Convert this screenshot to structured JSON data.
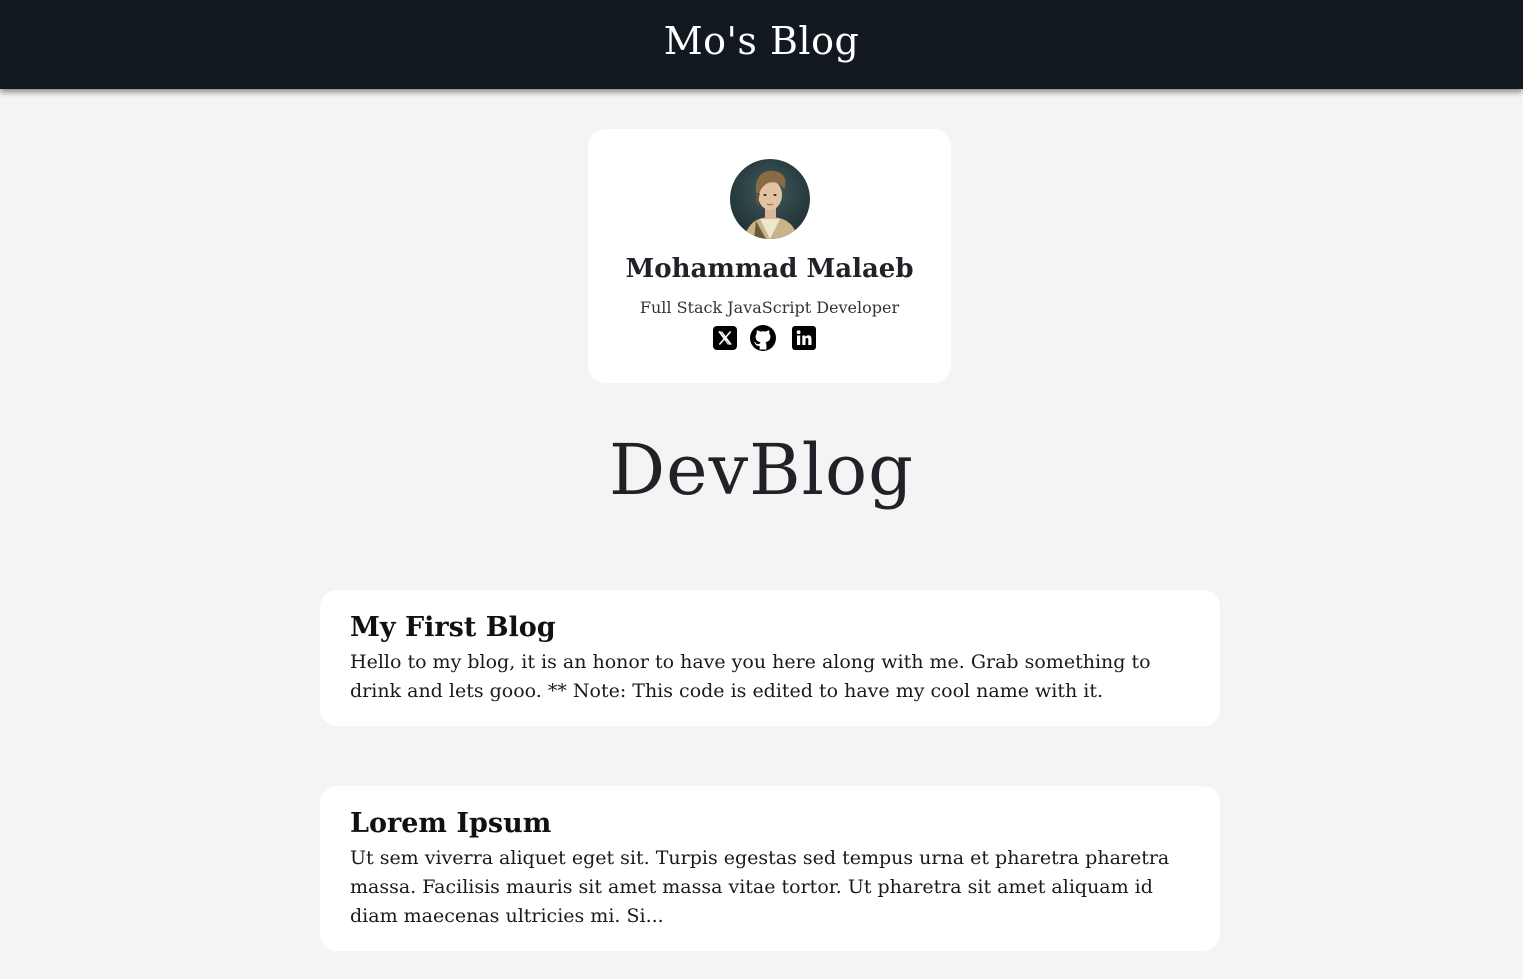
{
  "header": {
    "site_title": "Mo's Blog",
    "background_color": "#111820"
  },
  "profile": {
    "name": "Mohammad Malaeb",
    "role": "Full Stack JavaScript Developer",
    "avatar_icon": "avatar-portrait",
    "social_links": [
      {
        "name": "x-twitter-icon"
      },
      {
        "name": "github-icon"
      },
      {
        "name": "linkedin-icon"
      }
    ]
  },
  "main": {
    "heading": "DevBlog",
    "posts": [
      {
        "title": "My First Blog",
        "excerpt": "Hello to my blog, it is an honor to have you here along with me. Grab something to drink and lets gooo. ** Note: This code is edited to have my cool name with it."
      },
      {
        "title": "Lorem Ipsum",
        "excerpt": "Ut sem viverra aliquet eget sit. Turpis egestas sed tempus urna et pharetra pharetra massa. Facilisis mauris sit amet massa vitae tortor. Ut pharetra sit amet aliquam id diam maecenas ultricies mi. Si..."
      }
    ]
  },
  "colors": {
    "page_background": "#f4f4f4",
    "card_background": "#ffffff",
    "text": "#1f2328"
  }
}
